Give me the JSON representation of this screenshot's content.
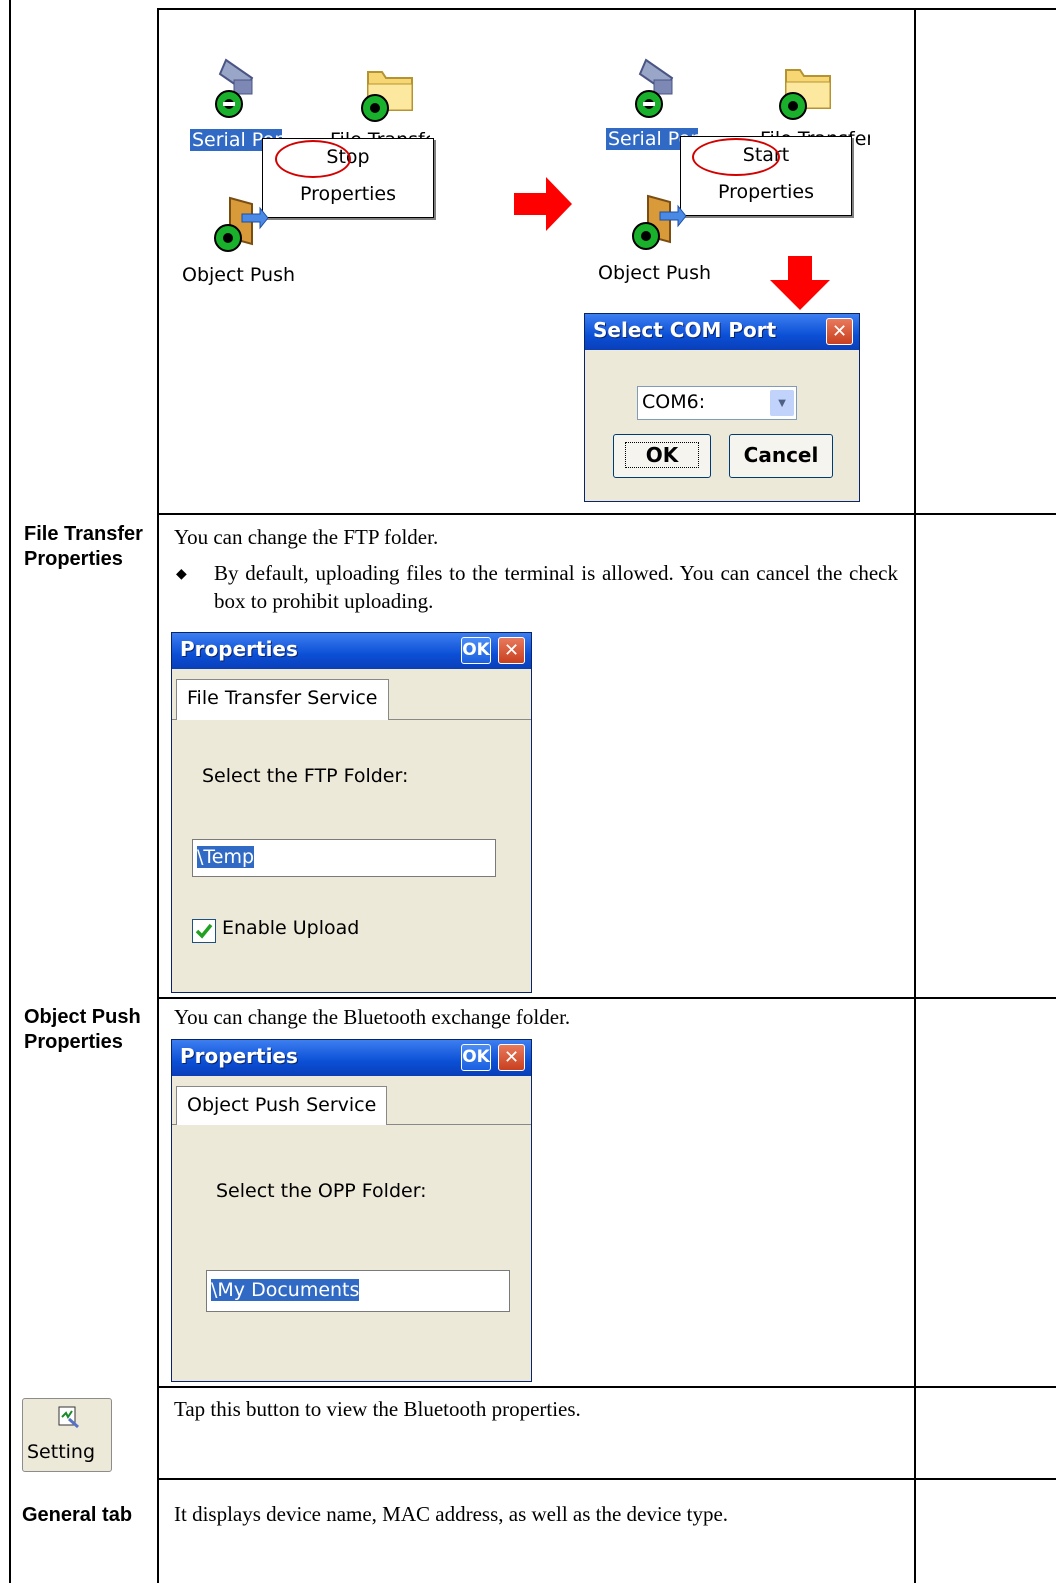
{
  "top_figure": {
    "left_panel": {
      "icons": {
        "serial_label": "Serial Port",
        "file_label": "File Transfer",
        "object_label": "Object Push"
      },
      "menu": {
        "item1": "Stop",
        "item2": "Properties"
      }
    },
    "right_panel": {
      "icons": {
        "serial_label": "Serial Port",
        "file_label": "File Transfer",
        "object_label": "Object Push"
      },
      "menu": {
        "item1": "Start",
        "item2": "Properties"
      }
    },
    "com_dialog": {
      "title": "Select COM Port",
      "combo_value": "COM6:",
      "ok_label": "OK",
      "cancel_label": "Cancel"
    }
  },
  "rows": [
    {
      "label": "File Transfer Properties",
      "description": "You can change the FTP folder.",
      "bullet": "By default, uploading files to the terminal is allowed. You can cancel the check box to prohibit uploading.",
      "dialog": {
        "title": "Properties",
        "ok_label": "OK",
        "tab_label": "File Transfer Service",
        "prompt": "Select the FTP Folder:",
        "folder_value": "\\Temp",
        "checkbox_label": "Enable Upload",
        "checkbox_checked": true
      }
    },
    {
      "label": "Object Push Properties",
      "description": "You can change the Bluetooth exchange folder.",
      "dialog": {
        "title": "Properties",
        "ok_label": "OK",
        "tab_label": "Object Push Service",
        "prompt": "Select the OPP Folder:",
        "folder_value": "\\My Documents"
      }
    },
    {
      "button_label": "Setting",
      "description": "Tap this button to view the Bluetooth properties."
    },
    {
      "label": "General tab",
      "description": "It displays device name, MAC address, as well as the device type."
    }
  ],
  "colors": {
    "arrow": "#ff0000",
    "highlight_ring": "#d40000",
    "selection": "#316ac5"
  }
}
